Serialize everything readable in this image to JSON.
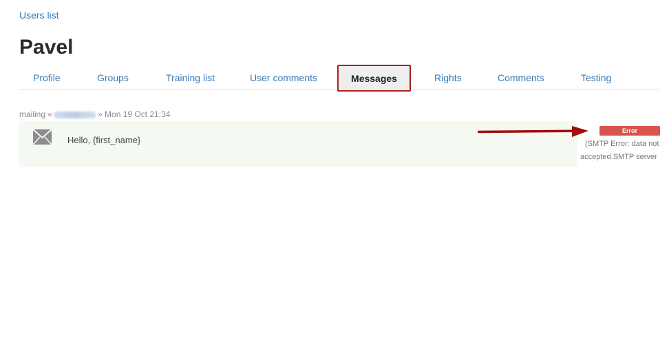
{
  "breadcrumb": {
    "label": "Users list"
  },
  "page": {
    "title": "Pavel"
  },
  "tabs": [
    {
      "label": "Profile"
    },
    {
      "label": "Groups"
    },
    {
      "label": "Training list"
    },
    {
      "label": "User comments"
    },
    {
      "label": "Messages",
      "active": true
    },
    {
      "label": "Rights"
    },
    {
      "label": "Comments"
    },
    {
      "label": "Testing"
    }
  ],
  "message": {
    "meta_prefix": "mailing «",
    "meta_suffix": "» Mon 19 Oct 21:34",
    "icon": "envelope-icon",
    "text": "Hello, {first_name}",
    "status": {
      "label": "Error",
      "detail_line1": "(SMTP Error: data not",
      "detail_line2": "accepted.SMTP server"
    }
  },
  "colors": {
    "link": "#3a78b5",
    "active_tab_border": "#a82020",
    "error_badge": "#d9534f",
    "message_row_bg": "#f4f9f2",
    "arrow": "#a30d0d"
  }
}
